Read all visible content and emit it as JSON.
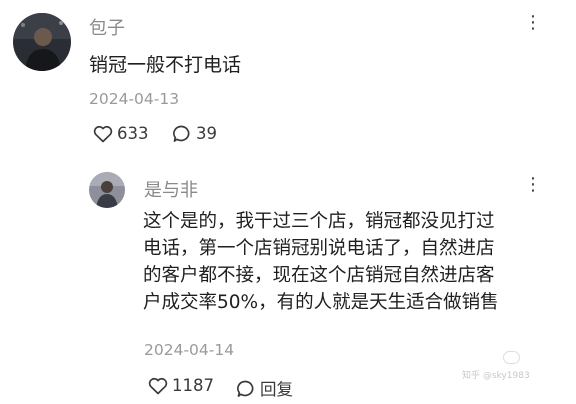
{
  "comment": {
    "username": "包子",
    "content": "销冠一般不打电话",
    "date": "2024-04-13",
    "likes": "633",
    "replies": "39",
    "more_icon": "more-icon"
  },
  "reply": {
    "username": "是与非",
    "lines": [
      "这个是的，我干过三个店，销冠都没见打过",
      "电话，第一个店销冠别说电话了，自然进店",
      "的客户都不接，现在这个店销冠自然进店客",
      "户成交率50%，有的人就是天生适合做销售"
    ],
    "date": "2024-04-14",
    "likes": "1187",
    "reply_label": "回复",
    "more_icon": "more-icon"
  },
  "watermark": {
    "text": "知乎 @sky1983"
  },
  "colors": {
    "text": "#1f1f1f",
    "muted": "#9a9a9a",
    "icon": "#3a3a3a"
  }
}
